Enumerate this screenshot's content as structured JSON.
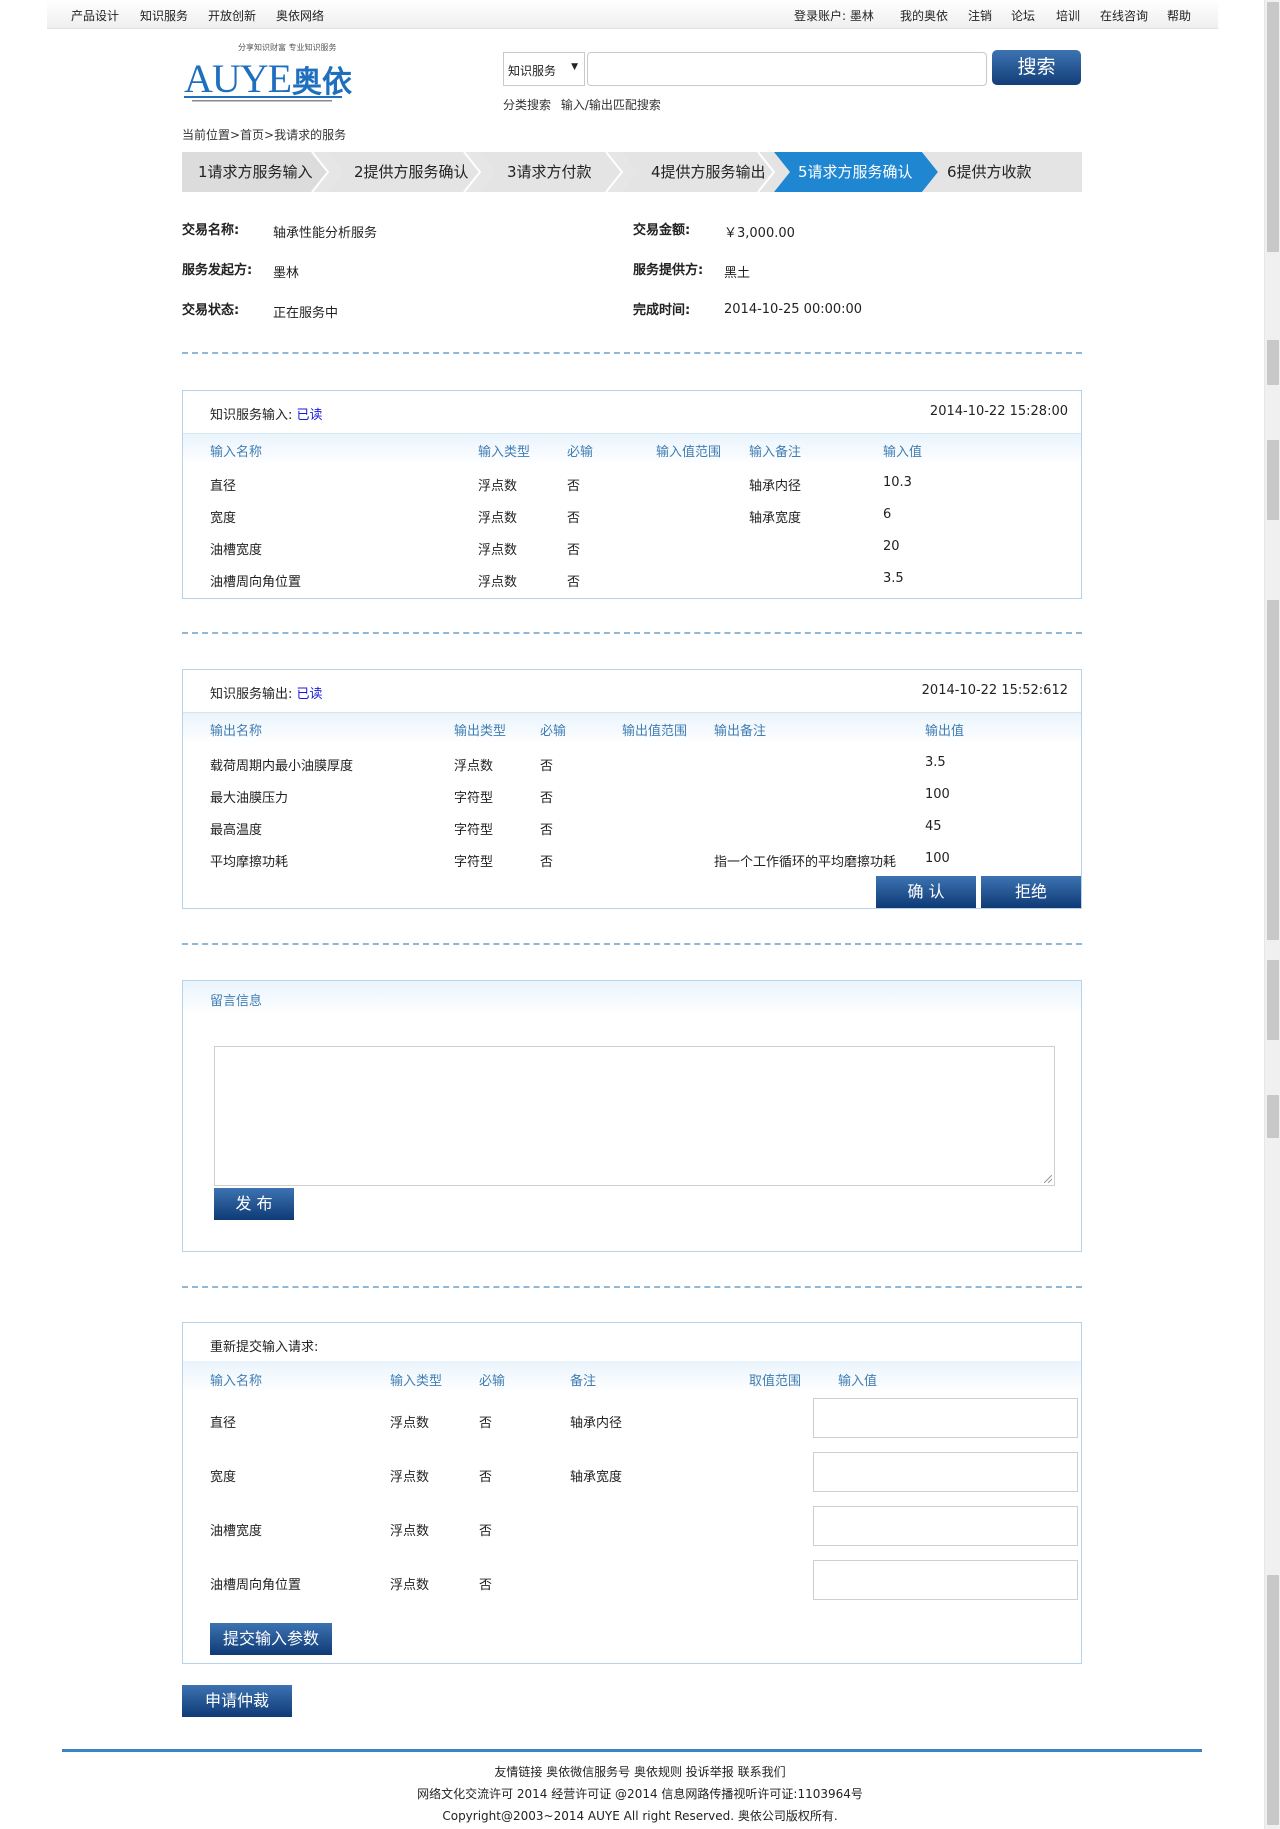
{
  "topnav": {
    "left": [
      "产品设计",
      "知识服务",
      "开放创新",
      "奥依网络"
    ],
    "right": [
      "登录账户: 墨林",
      "我的奥依",
      "注销",
      "论坛",
      "培训",
      "在线咨询",
      "帮助"
    ]
  },
  "logo": {
    "text": "AUYE",
    "cn": "奥依",
    "tagline": "分享知识财富 专业知识服务"
  },
  "search": {
    "select_value": "知识服务",
    "button": "搜索",
    "links": [
      "分类搜索",
      "输入/输出匹配搜索"
    ]
  },
  "breadcrumb": "当前位置>首页>我请求的服务",
  "steps": [
    "1请求方服务输入",
    "2提供方服务确认",
    "3请求方付款",
    "4提供方服务输出",
    "5请求方服务确认",
    "6提供方收款"
  ],
  "active_step": 5,
  "colors": {
    "accent": "#1f6fbf",
    "button": "#17467f",
    "panel_border": "#b6d3e9",
    "header_text": "#417eb3"
  },
  "trade": {
    "name_label": "交易名称:",
    "name": "轴承性能分析服务",
    "amount_label": "交易金额:",
    "amount": "￥3,000.00",
    "initiator_label": "服务发起方:",
    "initiator": "墨林",
    "provider_label": "服务提供方:",
    "provider": "黑土",
    "status_label": "交易状态:",
    "status": "正在服务中",
    "finish_label": "完成时间:",
    "finish": "2014-10-25 00:00:00"
  },
  "input_panel": {
    "title": "知识服务输入:",
    "read": "已读",
    "time": "2014-10-22 15:28:00",
    "headers": [
      "输入名称",
      "输入类型",
      "必输",
      "输入值范围",
      "输入备注",
      "输入值"
    ],
    "rows": [
      [
        "直径",
        "浮点数",
        "否",
        "",
        "轴承内径",
        "10.3"
      ],
      [
        "宽度",
        "浮点数",
        "否",
        "",
        "轴承宽度",
        "6"
      ],
      [
        "油槽宽度",
        "浮点数",
        "否",
        "",
        "",
        "20"
      ],
      [
        "油槽周向角位置",
        "浮点数",
        "否",
        "",
        "",
        "3.5"
      ]
    ]
  },
  "output_panel": {
    "title": "知识服务输出:",
    "read": "已读",
    "time": "2014-10-22 15:52:612",
    "headers": [
      "输出名称",
      "输出类型",
      "必输",
      "输出值范围",
      "输出备注",
      "输出值"
    ],
    "rows": [
      [
        "载荷周期内最小油膜厚度",
        "浮点数",
        "否",
        "",
        "",
        "3.5"
      ],
      [
        "最大油膜压力",
        "字符型",
        "否",
        "",
        "",
        "100"
      ],
      [
        "最高温度",
        "字符型",
        "否",
        "",
        "",
        "45"
      ],
      [
        "平均摩擦功耗",
        "字符型",
        "否",
        "",
        "指一个工作循环的平均磨擦功耗",
        "100"
      ]
    ],
    "confirm": "确 认",
    "reject": "拒绝"
  },
  "message": {
    "title": "留言信息",
    "publish": "发 布"
  },
  "resubmit": {
    "title": "重新提交输入请求:",
    "headers": [
      "输入名称",
      "输入类型",
      "必输",
      "备注",
      "取值范围",
      "输入值"
    ],
    "rows": [
      [
        "直径",
        "浮点数",
        "否",
        "轴承内径"
      ],
      [
        "宽度",
        "浮点数",
        "否",
        "轴承宽度"
      ],
      [
        "油槽宽度",
        "浮点数",
        "否",
        ""
      ],
      [
        "油槽周向角位置",
        "浮点数",
        "否",
        ""
      ]
    ],
    "submit": "提交输入参数"
  },
  "arbitration": "申请仲裁",
  "footer": {
    "links": "友情链接 奥依微信服务号 奥依规则 投诉举报 联系我们",
    "license": "网络文化交流许可 2014 经营许可证 @2014 信息网路传播视听许可证:1103964号",
    "copyright": "Copyright@2003~2014 AUYE All right Reserved. 奥依公司版权所有."
  }
}
